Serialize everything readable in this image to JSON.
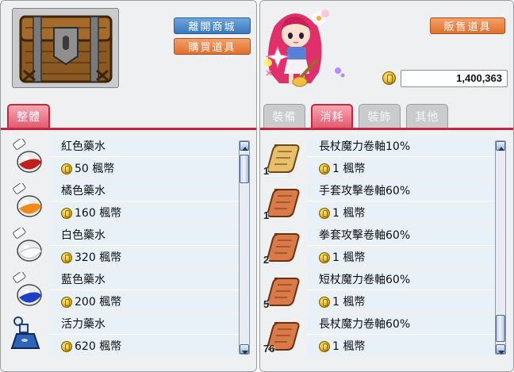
{
  "shop": {
    "leave_label": "離開商城",
    "buy_label": "購買道具",
    "tabs": [
      {
        "label": "整體",
        "active": true
      }
    ],
    "items": [
      {
        "name": "紅色藥水",
        "price": "50 楓幣",
        "icon": "red-potion-icon",
        "color": "#c0201c"
      },
      {
        "name": "橘色藥水",
        "price": "160 楓幣",
        "icon": "orange-potion-icon",
        "color": "#f08a1c"
      },
      {
        "name": "白色藥水",
        "price": "320 楓幣",
        "icon": "white-potion-icon",
        "color": "#f4f4f4"
      },
      {
        "name": "藍色藥水",
        "price": "200 楓幣",
        "icon": "blue-potion-icon",
        "color": "#1f3fc6"
      },
      {
        "name": "活力藥水",
        "price": "620 楓幣",
        "icon": "mana-elixir-icon",
        "color": "#2d63b8"
      }
    ]
  },
  "inventory": {
    "sell_label": "販售道具",
    "mesos": "1,400,363",
    "tabs": [
      {
        "label": "裝備",
        "active": false
      },
      {
        "label": "消耗",
        "active": true
      },
      {
        "label": "裝飾",
        "active": false
      },
      {
        "label": "其他",
        "active": false
      }
    ],
    "items": [
      {
        "name": "長杖魔力卷軸10%",
        "price": "1 楓幣",
        "qty": "1",
        "icon": "scroll-icon",
        "color": "#e8bf6a"
      },
      {
        "name": "手套攻擊卷軸60%",
        "price": "1 楓幣",
        "qty": "1",
        "icon": "scroll-icon",
        "color": "#d87a4a"
      },
      {
        "name": "拳套攻擊卷軸60%",
        "price": "1 楓幣",
        "qty": "2",
        "icon": "scroll-icon",
        "color": "#d87a4a"
      },
      {
        "name": "短杖魔力卷軸60%",
        "price": "1 楓幣",
        "qty": "5",
        "icon": "scroll-icon",
        "color": "#d87a4a"
      },
      {
        "name": "長杖魔力卷軸60%",
        "price": "1 楓幣",
        "qty": "76",
        "icon": "scroll-icon",
        "color": "#d87a4a"
      }
    ]
  },
  "colors": {
    "tab_accent": "#c0283d",
    "button_blue": "#3a77be",
    "button_orange": "#e0702d",
    "row_bg": "#e9f1f8"
  }
}
